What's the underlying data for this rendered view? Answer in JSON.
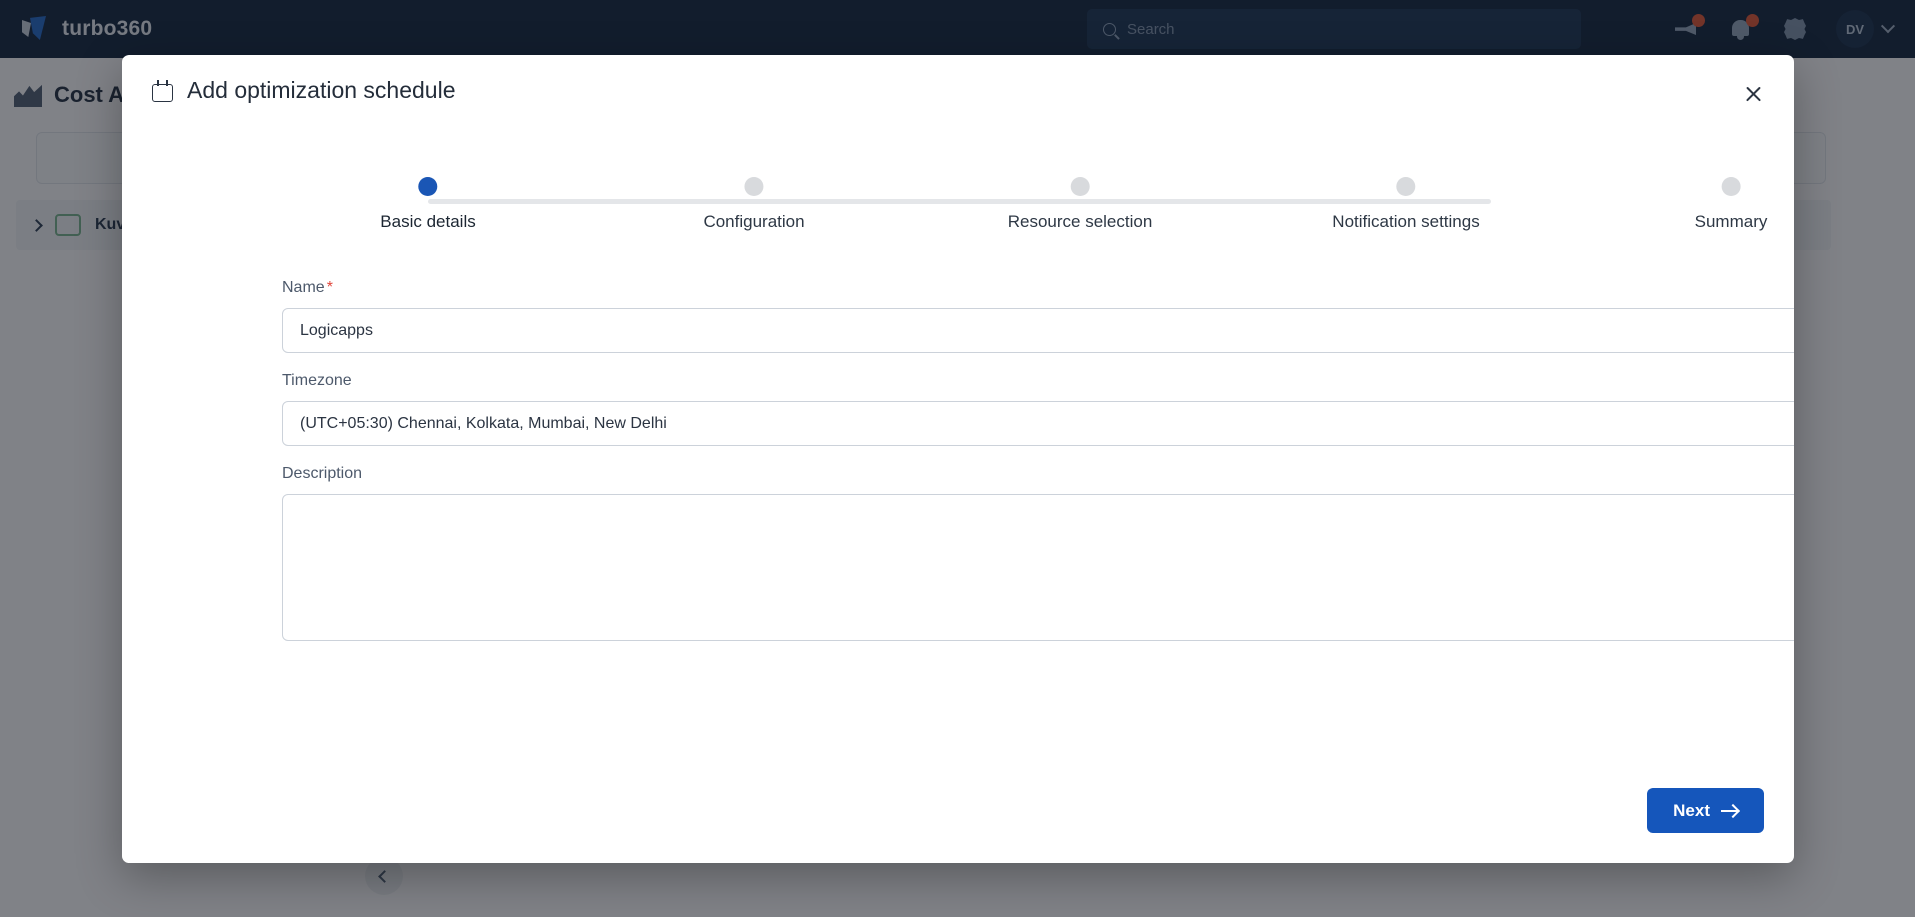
{
  "app": {
    "brand_name": "turbo360",
    "search": {
      "placeholder": "Search",
      "icon": "search-icon"
    },
    "header_icons": [
      {
        "name": "announcement-icon",
        "badge": ""
      },
      {
        "name": "notifications-icon",
        "badge": ""
      },
      {
        "name": "settings-gear-icon"
      }
    ],
    "avatar": {
      "initials": "DV"
    }
  },
  "background": {
    "page_title": "Cost An",
    "tree_row_label": "Kuva",
    "colors": {
      "primary": "#1556bb",
      "topbar": "#0d1f39"
    }
  },
  "modal": {
    "title": "Add optimization schedule",
    "title_icon": "calendar-icon",
    "close_icon": "close-icon",
    "stepper": {
      "active_index": 0,
      "steps": [
        {
          "label": "Basic details"
        },
        {
          "label": "Configuration"
        },
        {
          "label": "Resource selection"
        },
        {
          "label": "Notification settings"
        },
        {
          "label": "Summary"
        }
      ]
    },
    "fields": {
      "name": {
        "label": "Name",
        "required_marker": "*",
        "value": "Logicapps",
        "placeholder": "",
        "info_icon": "info-icon"
      },
      "timezone": {
        "label": "Timezone",
        "value": "(UTC+05:30) Chennai, Kolkata, Mumbai, New Delhi",
        "info_icon": "info-icon",
        "chevron_icon": "chevron-down-icon"
      },
      "description": {
        "label": "Description",
        "value": "",
        "placeholder": "",
        "info_icon": "info-icon"
      }
    },
    "footer": {
      "next_label": "Next",
      "next_icon": "arrow-right-icon"
    }
  }
}
